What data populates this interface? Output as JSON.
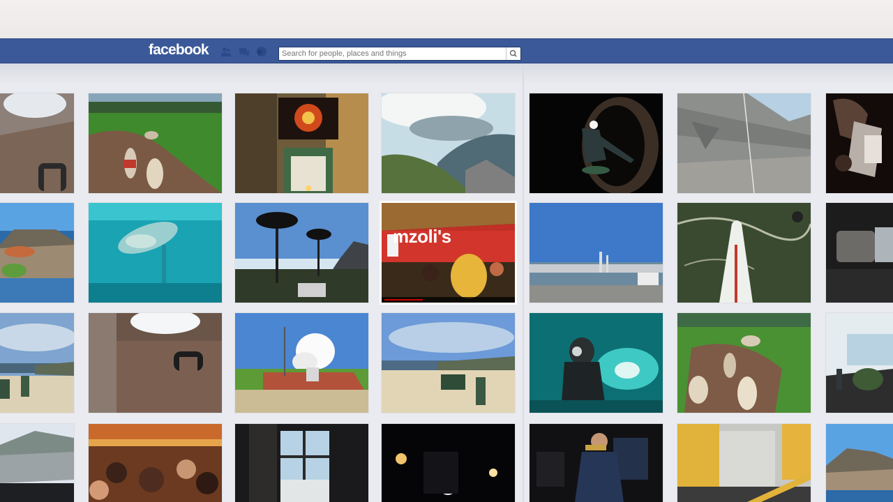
{
  "app": {
    "name": "facebook"
  },
  "colors": {
    "brand": "#3b5998",
    "page_bg": "#e9ebf0"
  },
  "header": {
    "logo_text": "facebook",
    "jewels": [
      "friend-requests-icon",
      "messages-icon",
      "notifications-globe-icon"
    ],
    "search": {
      "placeholder": "Search for people, places and things",
      "value": ""
    },
    "search_button_icon": "magnifier-icon"
  },
  "photos": {
    "rows": [
      [
        "skylight-corridor",
        "meerkat-lawn",
        "painting-doorway",
        "mountain-view-sky",
        "tunnel-diver-silhouette",
        "rock-climbing-wall",
        "dark-workshop"
      ],
      [
        "table-mountain-aerial",
        "aquarium-ray",
        "palm-trees-beach",
        "mzolis-restaurant-video",
        "waterfront-harbour",
        "surfboard-water",
        "car-interior"
      ],
      [
        "beach-sign-cloudy",
        "skylight-room",
        "cannon-smoke",
        "beach-sign-blue-sky",
        "underwater-diver",
        "penguins-lawn",
        "restaurant-terrace"
      ],
      [
        "car-road-mountain",
        "crowded-party-tent",
        "window-restaurant",
        "night-street-lights",
        "trumpet-player",
        "train-door",
        "coast-aerial"
      ]
    ],
    "video_caption": "mzoli's",
    "video_progress": 0.3
  }
}
